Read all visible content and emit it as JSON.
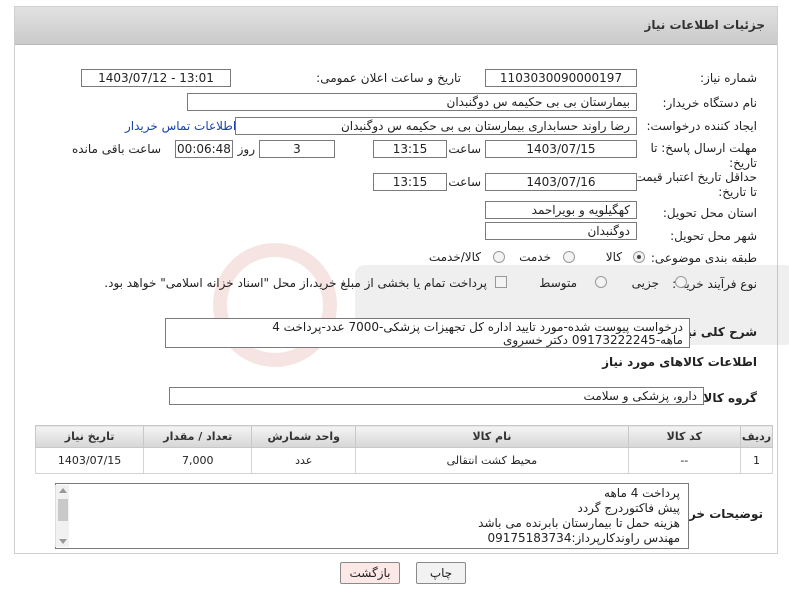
{
  "header": {
    "title": "جزئیات اطلاعات نیاز"
  },
  "form": {
    "need_number_label": "شماره نیاز:",
    "need_number": "1103030090000197",
    "announce_label": "تاریخ و ساعت اعلان عمومی:",
    "announce_value": "1403/07/12 - 13:01",
    "buyer_org_label": "نام دستگاه خریدار:",
    "buyer_org": "بیمارستان بی بی حکیمه س  دوگنبدان",
    "creator_label": "ایجاد کننده درخواست:",
    "creator": "رضا راوند حسابداری بیمارستان بی بی حکیمه س  دوگنبدان",
    "contact_link": "اطلاعات تماس خریدار",
    "deadline_label": "مهلت ارسال پاسخ: تا تاریخ:",
    "deadline_date": "1403/07/15",
    "time_label": "ساعت",
    "deadline_time": "13:15",
    "days_value": "3",
    "days_label": "روز و",
    "remaining_time": "00:06:48",
    "remaining_label": "ساعت باقی مانده",
    "validity_label": "حداقل تاریخ اعتبار قیمت: تا تاریخ:",
    "validity_date": "1403/07/16",
    "validity_time": "13:15",
    "province_label": "استان محل تحویل:",
    "province": "کهگیلویه و بویراحمد",
    "city_label": "شهر محل تحویل:",
    "city": "دوگنبدان",
    "category_label": "طبقه بندی موضوعی:",
    "category_options": [
      "کالا",
      "خدمت",
      "کالا/خدمت"
    ],
    "process_label": "نوع فرآیند خرید :",
    "process_options": [
      "جزیی",
      "متوسط"
    ],
    "payment_note": "پرداخت تمام یا بخشی از مبلغ خرید،از محل \"اسناد خزانه اسلامی\" خواهد بود."
  },
  "description": {
    "label": "شرح کلی نیاز:",
    "text": "درخواست پیوست شده-مورد تایید اداره کل تجهیزات پزشکی-7000 عدد-پرداخت 4 ماهه-09173222245 دکتر خسروی"
  },
  "goods": {
    "section_title": "اطلاعات کالاهای مورد نیاز",
    "group_label": "گروه کالا:",
    "group_value": "دارو، پزشکی و سلامت",
    "columns": [
      "ردیف",
      "کد کالا",
      "نام کالا",
      "واحد شمارش",
      "تعداد / مقدار",
      "تاریخ نیاز"
    ],
    "rows": [
      {
        "row": "1",
        "code": "--",
        "name": "محیط کشت انتقالی",
        "unit": "عدد",
        "qty": "7,000",
        "date": "1403/07/15"
      }
    ]
  },
  "buyer_notes": {
    "label": "توضیحات خریدار:",
    "lines": [
      "پرداخت 4 ماهه",
      "پیش فاکتوردرج گردد",
      "هزینه حمل تا بیمارستان بابرنده می باشد",
      "مهندس راوندکارپرداز:09175183734"
    ]
  },
  "buttons": {
    "print": "چاپ",
    "back": "بازگشت"
  },
  "colors": {
    "back_button_bg": "#fde8e8",
    "print_button_bg": "#f2f2f2",
    "link": "#1a3fb0"
  }
}
